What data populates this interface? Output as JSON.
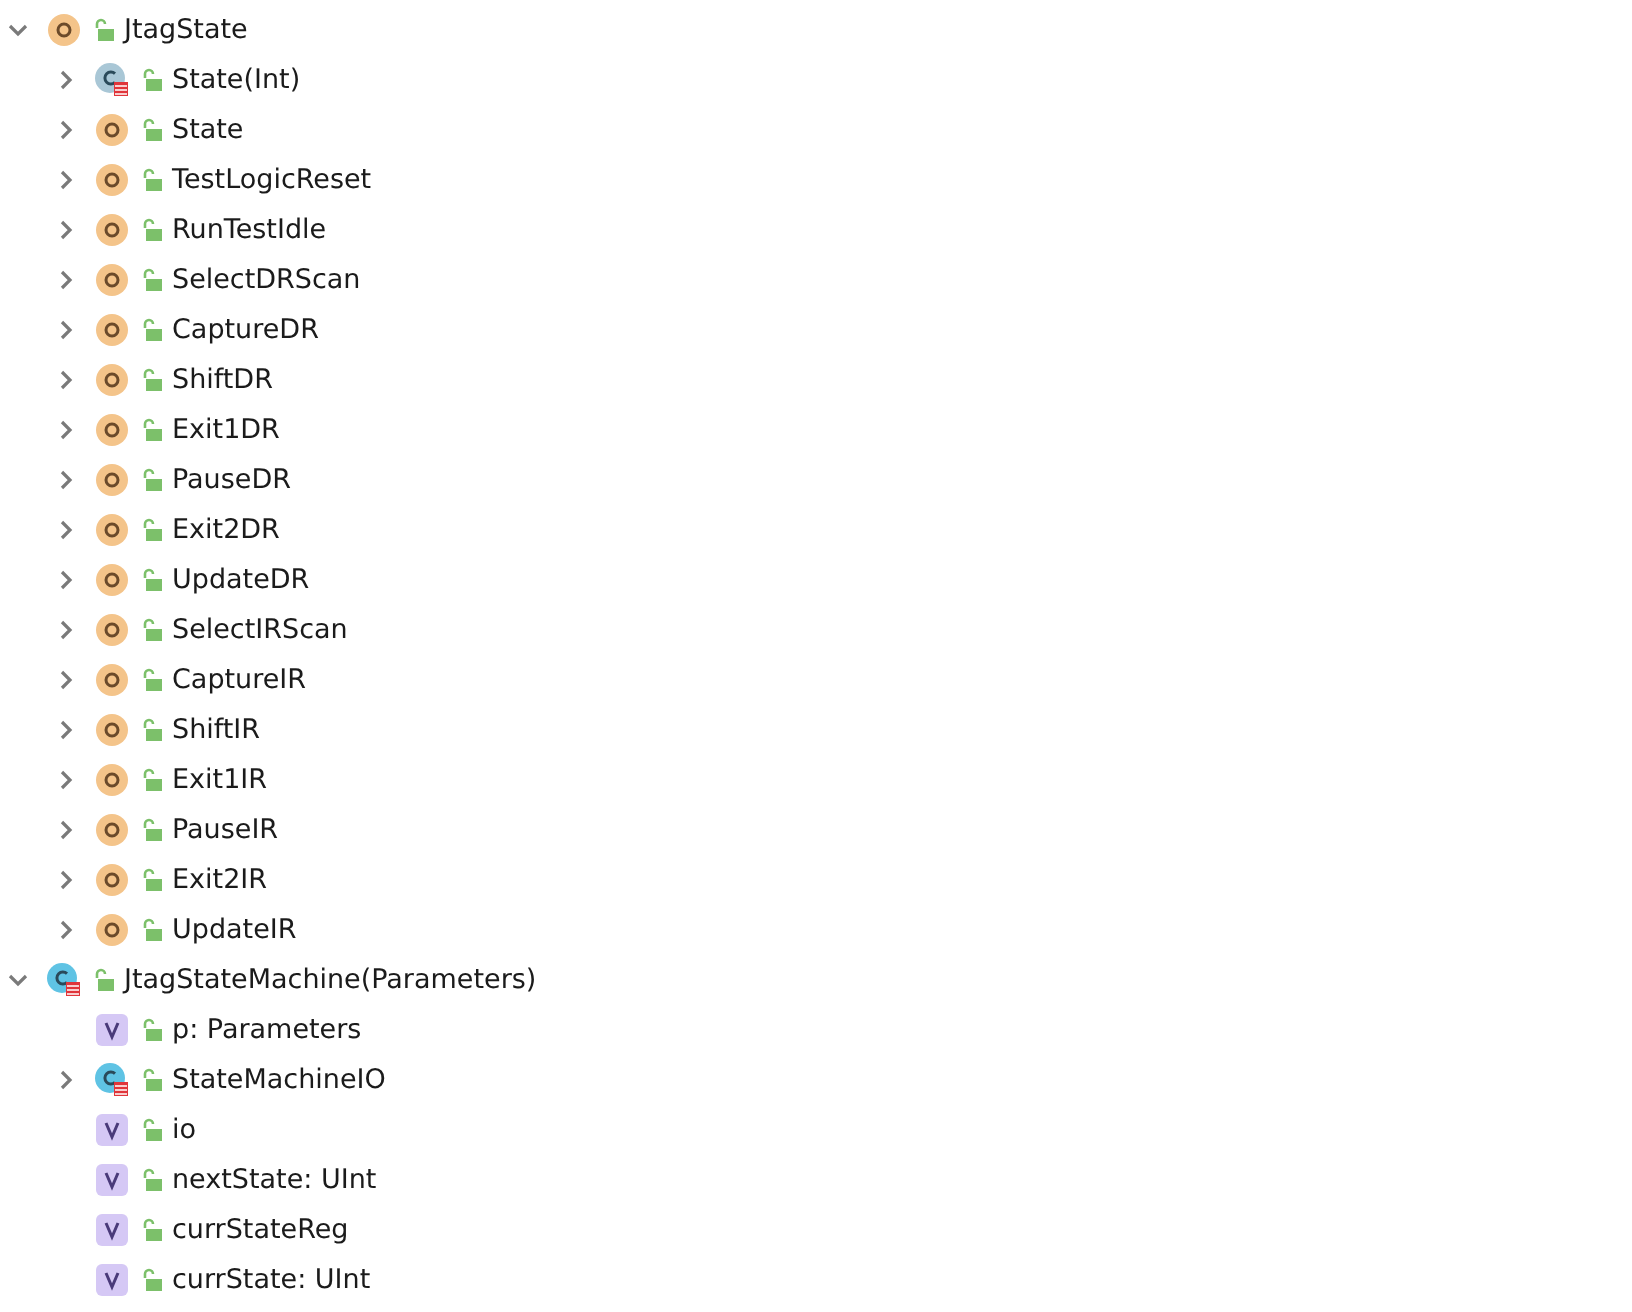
{
  "tree": [
    {
      "label": "JtagState",
      "kind": "object",
      "expanded": true,
      "children": [
        {
          "label": "State(Int)",
          "kind": "class-muted",
          "expanded": false
        },
        {
          "label": "State",
          "kind": "object",
          "expanded": false
        },
        {
          "label": "TestLogicReset",
          "kind": "object",
          "expanded": false
        },
        {
          "label": "RunTestIdle",
          "kind": "object",
          "expanded": false
        },
        {
          "label": "SelectDRScan",
          "kind": "object",
          "expanded": false
        },
        {
          "label": "CaptureDR",
          "kind": "object",
          "expanded": false
        },
        {
          "label": "ShiftDR",
          "kind": "object",
          "expanded": false
        },
        {
          "label": "Exit1DR",
          "kind": "object",
          "expanded": false
        },
        {
          "label": "PauseDR",
          "kind": "object",
          "expanded": false
        },
        {
          "label": "Exit2DR",
          "kind": "object",
          "expanded": false
        },
        {
          "label": "UpdateDR",
          "kind": "object",
          "expanded": false
        },
        {
          "label": "SelectIRScan",
          "kind": "object",
          "expanded": false
        },
        {
          "label": "CaptureIR",
          "kind": "object",
          "expanded": false
        },
        {
          "label": "ShiftIR",
          "kind": "object",
          "expanded": false
        },
        {
          "label": "Exit1IR",
          "kind": "object",
          "expanded": false
        },
        {
          "label": "PauseIR",
          "kind": "object",
          "expanded": false
        },
        {
          "label": "Exit2IR",
          "kind": "object",
          "expanded": false
        },
        {
          "label": "UpdateIR",
          "kind": "object",
          "expanded": false
        }
      ]
    },
    {
      "label": "JtagStateMachine(Parameters)",
      "kind": "class",
      "expanded": true,
      "children": [
        {
          "label": "p: Parameters",
          "kind": "value"
        },
        {
          "label": "StateMachineIO",
          "kind": "class",
          "expanded": false
        },
        {
          "label": "io",
          "kind": "value"
        },
        {
          "label": "nextState: UInt",
          "kind": "value"
        },
        {
          "label": "currStateReg",
          "kind": "value"
        },
        {
          "label": "currState: UInt",
          "kind": "value"
        }
      ]
    }
  ]
}
